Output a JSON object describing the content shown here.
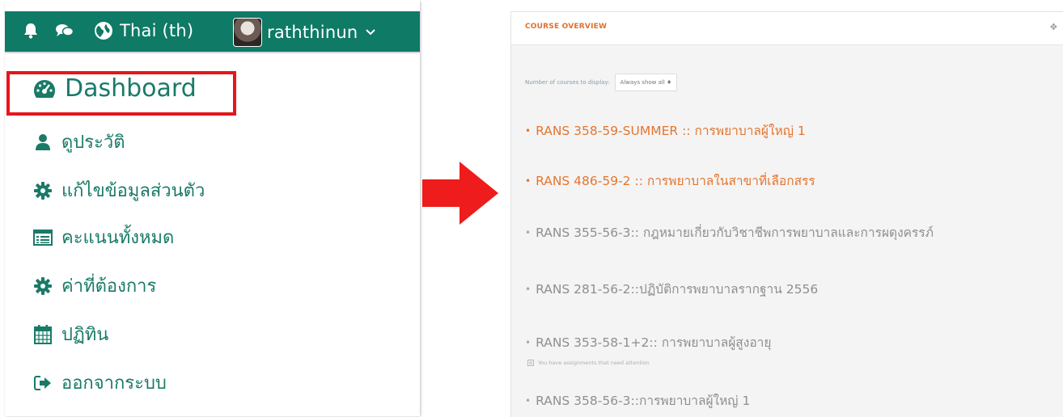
{
  "topbar": {
    "language": "Thai (th)",
    "username": "raththinun",
    "bg_color": "#0f7a66"
  },
  "menu": {
    "items": [
      {
        "label": "Dashboard",
        "icon": "dashboard-icon"
      },
      {
        "label": "ดูประวัติ",
        "icon": "user-icon"
      },
      {
        "label": "แก้ไขข้อมูลส่วนตัว",
        "icon": "gear-icon"
      },
      {
        "label": "คะแนนทั้งหมด",
        "icon": "grades-table-icon"
      },
      {
        "label": "ค่าที่ต้องการ",
        "icon": "gear-icon"
      },
      {
        "label": "ปฏิทิน",
        "icon": "calendar-icon"
      },
      {
        "label": "ออกจากระบบ",
        "icon": "logout-icon"
      }
    ],
    "text_color": "#1a7a68",
    "highlight_color": "#e8141b"
  },
  "arrow_color": "#ee1c1c",
  "course_overview": {
    "title": "COURSE OVERVIEW",
    "num_courses_label": "Number of courses to display:",
    "num_courses_value": "Always show all ♦",
    "courses": [
      {
        "text": "RANS 358-59-SUMMER :: การพยาบาลผู้ใหญ่ 1",
        "state": "active"
      },
      {
        "text": "RANS 486-59-2 :: การพยาบาลในสาขาที่เลือกสรร",
        "state": "active"
      },
      {
        "text": "RANS 355-56-3:: กฎหมายเกี่ยวกับวิชาชีพการพยาบาลและการผดุงครรภ์",
        "state": "inactive"
      },
      {
        "text": "RANS 281-56-2::ปฏิบัติการพยาบาลรากฐาน 2556",
        "state": "inactive"
      },
      {
        "text": "RANS 353-58-1+2:: การพยาบาลผู้สูงอายุ",
        "state": "inactive"
      },
      {
        "text": "RANS 358-56-3::การพยาบาลผู้ใหญ่ 1",
        "state": "inactive"
      }
    ],
    "notice": "You have assignments that need attention",
    "accent_color": "#e4762f"
  }
}
